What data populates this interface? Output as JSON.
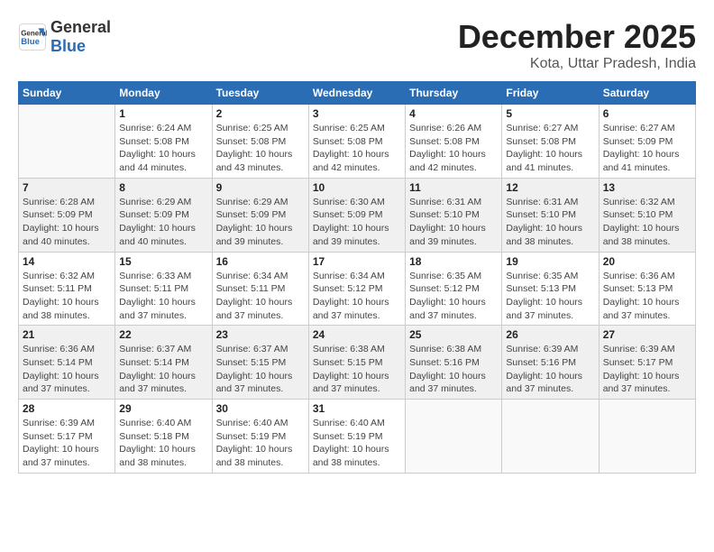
{
  "header": {
    "logo_general": "General",
    "logo_blue": "Blue",
    "title": "December 2025",
    "location": "Kota, Uttar Pradesh, India"
  },
  "weekdays": [
    "Sunday",
    "Monday",
    "Tuesday",
    "Wednesday",
    "Thursday",
    "Friday",
    "Saturday"
  ],
  "weeks": [
    [
      {
        "day": "",
        "detail": ""
      },
      {
        "day": "1",
        "detail": "Sunrise: 6:24 AM\nSunset: 5:08 PM\nDaylight: 10 hours\nand 44 minutes."
      },
      {
        "day": "2",
        "detail": "Sunrise: 6:25 AM\nSunset: 5:08 PM\nDaylight: 10 hours\nand 43 minutes."
      },
      {
        "day": "3",
        "detail": "Sunrise: 6:25 AM\nSunset: 5:08 PM\nDaylight: 10 hours\nand 42 minutes."
      },
      {
        "day": "4",
        "detail": "Sunrise: 6:26 AM\nSunset: 5:08 PM\nDaylight: 10 hours\nand 42 minutes."
      },
      {
        "day": "5",
        "detail": "Sunrise: 6:27 AM\nSunset: 5:08 PM\nDaylight: 10 hours\nand 41 minutes."
      },
      {
        "day": "6",
        "detail": "Sunrise: 6:27 AM\nSunset: 5:09 PM\nDaylight: 10 hours\nand 41 minutes."
      }
    ],
    [
      {
        "day": "7",
        "detail": "Sunrise: 6:28 AM\nSunset: 5:09 PM\nDaylight: 10 hours\nand 40 minutes."
      },
      {
        "day": "8",
        "detail": "Sunrise: 6:29 AM\nSunset: 5:09 PM\nDaylight: 10 hours\nand 40 minutes."
      },
      {
        "day": "9",
        "detail": "Sunrise: 6:29 AM\nSunset: 5:09 PM\nDaylight: 10 hours\nand 39 minutes."
      },
      {
        "day": "10",
        "detail": "Sunrise: 6:30 AM\nSunset: 5:09 PM\nDaylight: 10 hours\nand 39 minutes."
      },
      {
        "day": "11",
        "detail": "Sunrise: 6:31 AM\nSunset: 5:10 PM\nDaylight: 10 hours\nand 39 minutes."
      },
      {
        "day": "12",
        "detail": "Sunrise: 6:31 AM\nSunset: 5:10 PM\nDaylight: 10 hours\nand 38 minutes."
      },
      {
        "day": "13",
        "detail": "Sunrise: 6:32 AM\nSunset: 5:10 PM\nDaylight: 10 hours\nand 38 minutes."
      }
    ],
    [
      {
        "day": "14",
        "detail": "Sunrise: 6:32 AM\nSunset: 5:11 PM\nDaylight: 10 hours\nand 38 minutes."
      },
      {
        "day": "15",
        "detail": "Sunrise: 6:33 AM\nSunset: 5:11 PM\nDaylight: 10 hours\nand 37 minutes."
      },
      {
        "day": "16",
        "detail": "Sunrise: 6:34 AM\nSunset: 5:11 PM\nDaylight: 10 hours\nand 37 minutes."
      },
      {
        "day": "17",
        "detail": "Sunrise: 6:34 AM\nSunset: 5:12 PM\nDaylight: 10 hours\nand 37 minutes."
      },
      {
        "day": "18",
        "detail": "Sunrise: 6:35 AM\nSunset: 5:12 PM\nDaylight: 10 hours\nand 37 minutes."
      },
      {
        "day": "19",
        "detail": "Sunrise: 6:35 AM\nSunset: 5:13 PM\nDaylight: 10 hours\nand 37 minutes."
      },
      {
        "day": "20",
        "detail": "Sunrise: 6:36 AM\nSunset: 5:13 PM\nDaylight: 10 hours\nand 37 minutes."
      }
    ],
    [
      {
        "day": "21",
        "detail": "Sunrise: 6:36 AM\nSunset: 5:14 PM\nDaylight: 10 hours\nand 37 minutes."
      },
      {
        "day": "22",
        "detail": "Sunrise: 6:37 AM\nSunset: 5:14 PM\nDaylight: 10 hours\nand 37 minutes."
      },
      {
        "day": "23",
        "detail": "Sunrise: 6:37 AM\nSunset: 5:15 PM\nDaylight: 10 hours\nand 37 minutes."
      },
      {
        "day": "24",
        "detail": "Sunrise: 6:38 AM\nSunset: 5:15 PM\nDaylight: 10 hours\nand 37 minutes."
      },
      {
        "day": "25",
        "detail": "Sunrise: 6:38 AM\nSunset: 5:16 PM\nDaylight: 10 hours\nand 37 minutes."
      },
      {
        "day": "26",
        "detail": "Sunrise: 6:39 AM\nSunset: 5:16 PM\nDaylight: 10 hours\nand 37 minutes."
      },
      {
        "day": "27",
        "detail": "Sunrise: 6:39 AM\nSunset: 5:17 PM\nDaylight: 10 hours\nand 37 minutes."
      }
    ],
    [
      {
        "day": "28",
        "detail": "Sunrise: 6:39 AM\nSunset: 5:17 PM\nDaylight: 10 hours\nand 37 minutes."
      },
      {
        "day": "29",
        "detail": "Sunrise: 6:40 AM\nSunset: 5:18 PM\nDaylight: 10 hours\nand 38 minutes."
      },
      {
        "day": "30",
        "detail": "Sunrise: 6:40 AM\nSunset: 5:19 PM\nDaylight: 10 hours\nand 38 minutes."
      },
      {
        "day": "31",
        "detail": "Sunrise: 6:40 AM\nSunset: 5:19 PM\nDaylight: 10 hours\nand 38 minutes."
      },
      {
        "day": "",
        "detail": ""
      },
      {
        "day": "",
        "detail": ""
      },
      {
        "day": "",
        "detail": ""
      }
    ]
  ]
}
